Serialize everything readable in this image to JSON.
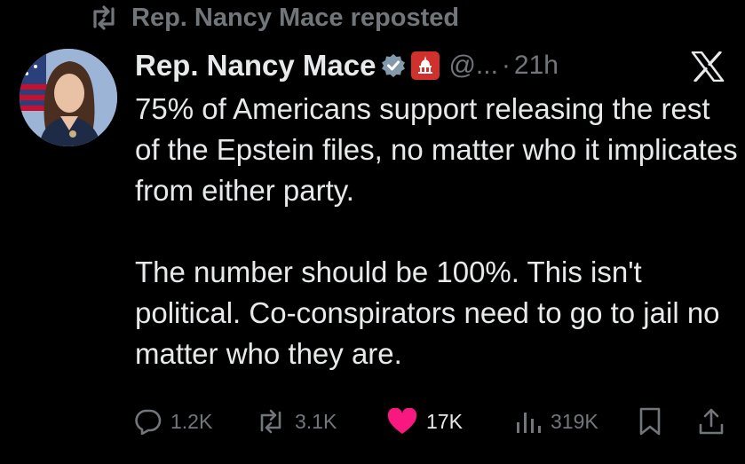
{
  "repost": {
    "text": "Rep. Nancy Mace reposted"
  },
  "post": {
    "author_name": "Rep. Nancy Mace",
    "handle": "@...",
    "separator": "·",
    "time": "21h",
    "paragraphs": [
      "75% of Americans support releasing the rest of the Epstein files, no matter who it implicates from either party.",
      "The number should be 100%. This isn't political. Co-conspirators need to go to jail no matter who they are."
    ]
  },
  "actions": {
    "replies": "1.2K",
    "reposts": "3.1K",
    "likes": "17K",
    "views": "319K"
  },
  "colors": {
    "background": "#000000",
    "text": "#e7e9ea",
    "muted": "#71767b",
    "like": "#f91880",
    "verified": "#829aab",
    "gop_badge": "#d0312d"
  },
  "icons": [
    "repost-icon",
    "verified-badge-icon",
    "gop-badge-icon",
    "x-logo-icon",
    "reply-icon",
    "like-icon",
    "views-icon",
    "bookmark-icon",
    "share-icon"
  ]
}
